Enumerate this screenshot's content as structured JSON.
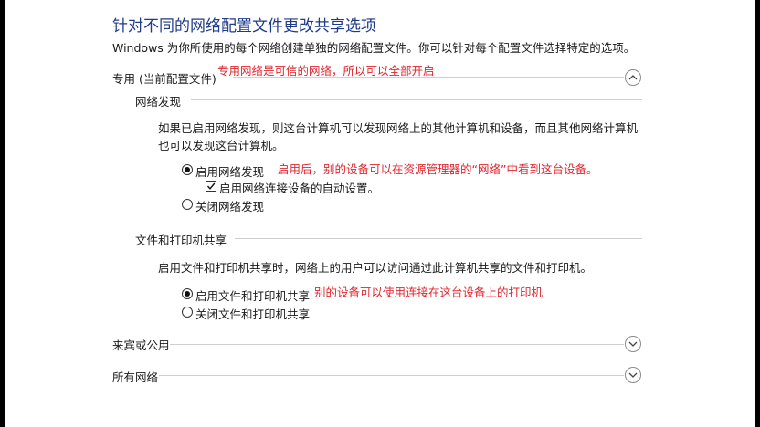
{
  "page": {
    "title": "针对不同的网络配置文件更改共享选项",
    "description": "Windows 为你所使用的每个网络创建单独的网络配置文件。你可以针对每个配置文件选择特定的选项。"
  },
  "private_profile": {
    "label": "专用 (当前配置文件)",
    "annotation": "专用网络是可信的网络，所以可以全部开启",
    "network_discovery": {
      "heading": "网络发现",
      "description": "如果已启用网络发现，则这台计算机可以发现网络上的其他计算机和设备，而且其他网络计算机也可以发现这台计算机。",
      "enable_label": "启用网络发现",
      "enable_annotation": "启用后，别的设备可以在资源管理器的“网络”中看到这台设备。",
      "auto_setup_label": "启用网络连接设备的自动设置。",
      "disable_label": "关闭网络发现",
      "enabled": true,
      "auto_setup_checked": true
    },
    "file_printer_sharing": {
      "heading": "文件和打印机共享",
      "description": "启用文件和打印机共享时，网络上的用户可以访问通过此计算机共享的文件和打印机。",
      "enable_label": "启用文件和打印机共享",
      "enable_annotation": "别的设备可以使用连接在这台设备上的打印机",
      "disable_label": "关闭文件和打印机共享",
      "enabled": true
    }
  },
  "guest_public": {
    "label": "来宾或公用"
  },
  "all_networks": {
    "label": "所有网络"
  },
  "colors": {
    "title": "#1e3a8a",
    "annotation": "#e0262e",
    "divider": "#cfcfcf"
  },
  "icons": {
    "expanded": "chevron-up-icon",
    "collapsed": "chevron-down-icon"
  }
}
